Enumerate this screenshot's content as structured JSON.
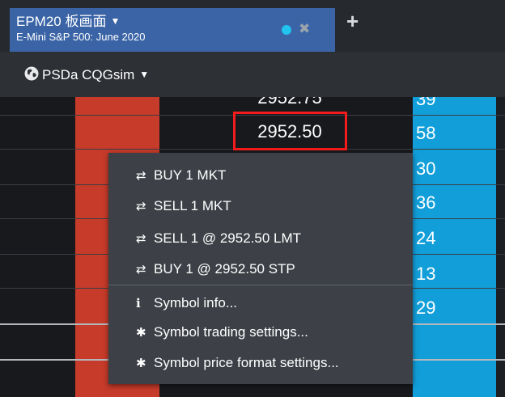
{
  "tab": {
    "title": "EPM20 板画面",
    "subtitle": "E-Mini S&P 500: June 2020",
    "caret": "▼",
    "close": "✖",
    "add": "+",
    "indicator_color": "#20c4ef"
  },
  "account": {
    "label": "PSDa CQGsim",
    "caret": "▼"
  },
  "ladder": {
    "prices": [
      {
        "price": "2952.75",
        "ask_qty": "39"
      },
      {
        "price": "2952.50",
        "ask_qty": "58"
      }
    ],
    "ask_qty_more": [
      "30",
      "36",
      "24",
      "13",
      "29"
    ],
    "selected_price": "2952.50",
    "colors": {
      "bid_column": "#c63b2a",
      "ask_column": "#119ed9",
      "highlight": "#f21c1c"
    }
  },
  "context_menu": {
    "items": [
      {
        "icon": "transfer-icon",
        "glyph": "⇄",
        "label": "BUY 1 MKT"
      },
      {
        "icon": "transfer-icon",
        "glyph": "⇄",
        "label": "SELL 1 MKT"
      },
      {
        "icon": "transfer-icon",
        "glyph": "⇄",
        "label": "SELL 1 @ 2952.50 LMT"
      },
      {
        "icon": "transfer-icon",
        "glyph": "⇄",
        "label": "BUY 1 @ 2952.50 STP"
      },
      {
        "icon": "info-icon",
        "glyph": "ℹ",
        "label": "Symbol info..."
      },
      {
        "icon": "gear-icon",
        "glyph": "✱",
        "label": "Symbol trading settings..."
      },
      {
        "icon": "gear-icon",
        "glyph": "✱",
        "label": "Symbol price format settings..."
      }
    ]
  }
}
